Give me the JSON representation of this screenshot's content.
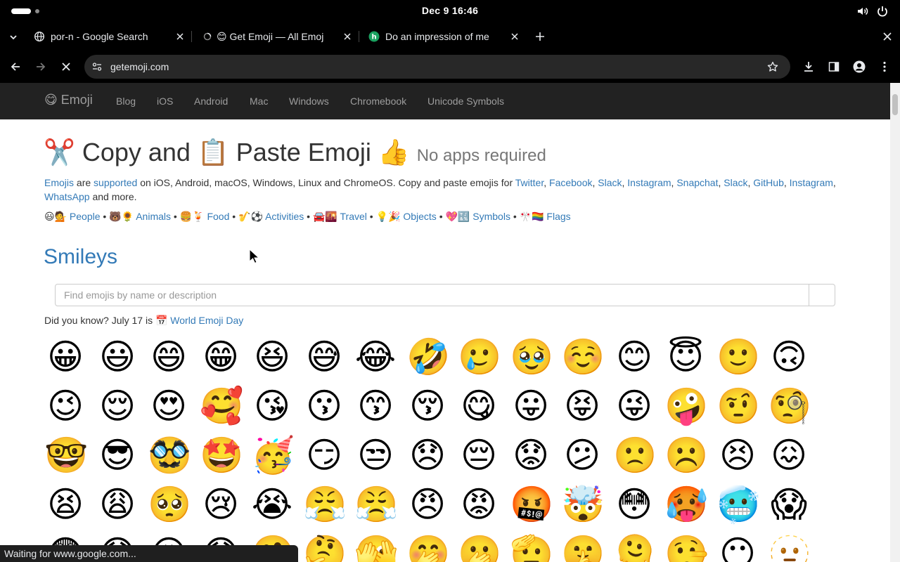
{
  "os": {
    "clock": "Dec 9  16:46"
  },
  "tabs": [
    {
      "title": "por-n - Google Search",
      "icon": "google-globe-icon"
    },
    {
      "title": "😊 Get Emoji — All Emoj",
      "icon": "getemoji-icon"
    },
    {
      "title": "Do an impression of me",
      "icon": "grammar-icon"
    }
  ],
  "toolbar": {
    "url": "getemoji.com"
  },
  "nav": {
    "brand": "😋 Emoji",
    "links": [
      "Blog",
      "iOS",
      "Android",
      "Mac",
      "Windows",
      "Chromebook",
      "Unicode Symbols"
    ]
  },
  "hero": {
    "pre": "✂️ Copy and 📋 Paste Emoji 👍",
    "sub": "No apps required"
  },
  "intro": {
    "w1": "Emojis",
    "t1": " are ",
    "w2": "supported",
    "t2": " on iOS, Android, macOS, Windows, Linux and ChromeOS. Copy and paste emojis for ",
    "links": [
      "Twitter",
      "Facebook",
      "Slack",
      "Instagram",
      "Snapchat",
      "Slack",
      "GitHub",
      "Instagram",
      "WhatsApp"
    ],
    "tail": " and more."
  },
  "categories": [
    {
      "icons": "😃💁",
      "label": "People"
    },
    {
      "icons": "🐻🌻",
      "label": "Animals"
    },
    {
      "icons": "🍔🍹",
      "label": "Food"
    },
    {
      "icons": "🎷⚽️",
      "label": "Activities"
    },
    {
      "icons": "🚘🌇",
      "label": "Travel"
    },
    {
      "icons": "💡🎉",
      "label": "Objects"
    },
    {
      "icons": "💖🔣",
      "label": "Symbols"
    },
    {
      "icons": "🎌🏳️‍🌈",
      "label": "Flags"
    }
  ],
  "section_title": "Smileys",
  "search": {
    "placeholder": "Find emojis by name or description"
  },
  "didyouknow": {
    "text": "Did you know? July 17 is 📅 ",
    "link": "World Emoji Day"
  },
  "emoji_rows": [
    [
      "😀",
      "😃",
      "😄",
      "😁",
      "😆",
      "😅",
      "😂",
      "🤣",
      "🥲",
      "🥹",
      "☺️",
      "😊",
      "😇",
      "🙂",
      "🙃"
    ],
    [
      "😉",
      "😌",
      "😍",
      "🥰",
      "😘",
      "😗",
      "😙",
      "😚",
      "😋",
      "😛",
      "😝",
      "😜",
      "🤪",
      "🤨",
      "🧐"
    ],
    [
      "🤓",
      "😎",
      "🥸",
      "🤩",
      "🥳",
      "😏",
      "😒",
      "😞",
      "😔",
      "😟",
      "😕",
      "🙁",
      "☹️",
      "😣",
      "😖"
    ],
    [
      "😫",
      "😩",
      "🥺",
      "😢",
      "😭",
      "😤",
      "😤",
      "😠",
      "😡",
      "🤬",
      "🤯",
      "😳",
      "🥵",
      "🥶",
      "😱"
    ],
    [
      "😨",
      "😰",
      "😥",
      "😓",
      "🤗",
      "🤔",
      "🫣",
      "🤭",
      "🫢",
      "🫡",
      "🤫",
      "🫠",
      "🤥",
      "😶",
      "🫥"
    ]
  ],
  "status_text": "Waiting for www.google.com..."
}
